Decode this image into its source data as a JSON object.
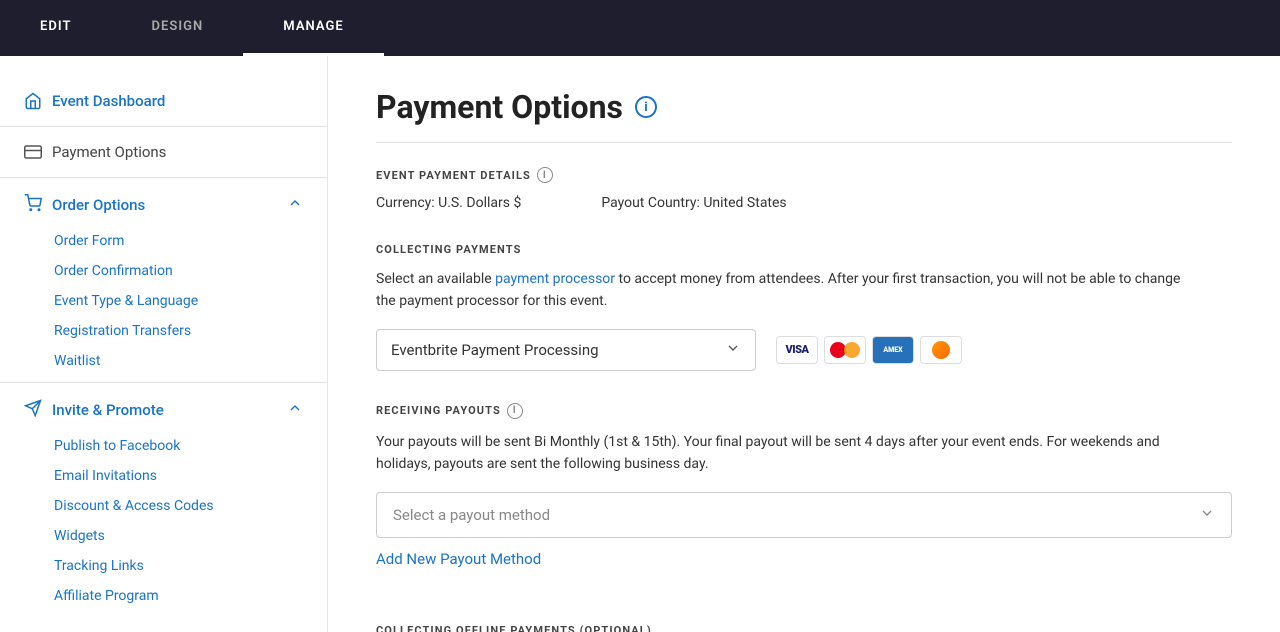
{
  "topNav": {
    "items": [
      {
        "label": "EDIT",
        "active": false
      },
      {
        "label": "DESIGN",
        "active": false
      },
      {
        "label": "MANAGE",
        "active": true
      }
    ]
  },
  "sidebar": {
    "eventDashboard": {
      "label": "Event Dashboard"
    },
    "paymentOptions": {
      "label": "Payment Options"
    },
    "orderOptions": {
      "label": "Order Options",
      "items": [
        {
          "label": "Order Form"
        },
        {
          "label": "Order Confirmation"
        },
        {
          "label": "Event Type & Language"
        },
        {
          "label": "Registration Transfers"
        },
        {
          "label": "Waitlist"
        }
      ]
    },
    "invitePromote": {
      "label": "Invite & Promote",
      "items": [
        {
          "label": "Publish to Facebook"
        },
        {
          "label": "Email Invitations"
        },
        {
          "label": "Discount & Access Codes"
        },
        {
          "label": "Widgets"
        },
        {
          "label": "Tracking Links"
        },
        {
          "label": "Affiliate Program"
        }
      ]
    }
  },
  "main": {
    "pageTitle": "Payment Options",
    "sections": {
      "eventPaymentDetails": {
        "title": "EVENT PAYMENT DETAILS",
        "currency": "Currency: U.S. Dollars $",
        "payoutCountry": "Payout Country: United States"
      },
      "collectingPayments": {
        "title": "COLLECTING PAYMENTS",
        "description1": "Select an available ",
        "link": "payment processor",
        "description2": " to accept money from attendees. After your first transaction, you will not be able to change the payment processor for this event.",
        "processorDropdown": "Eventbrite Payment Processing",
        "cards": [
          "VISA",
          "MC",
          "AMEX",
          "DISCOVER"
        ]
      },
      "receivingPayouts": {
        "title": "RECEIVING PAYOUTS",
        "description": "Your payouts will be sent Bi Monthly (1st & 15th). Your final payout will be sent 4 days after your event ends. For weekends and holidays, payouts are sent the following business day.",
        "selectPlaceholder": "Select a payout method",
        "addLink": "Add New Payout Method"
      },
      "collectingOffline": {
        "title": "COLLECTING OFFLINE PAYMENTS (OPTIONAL)"
      }
    }
  }
}
